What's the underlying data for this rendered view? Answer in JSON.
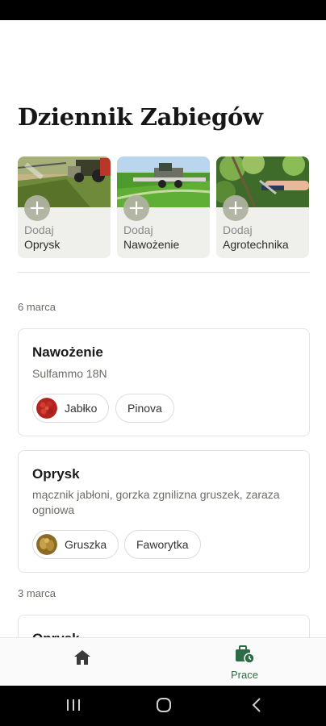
{
  "header": {
    "title": "Dziennik Zabiegów"
  },
  "quick_actions": [
    {
      "line1": "Dodaj",
      "line2": "Oprysk"
    },
    {
      "line1": "Dodaj",
      "line2": "Nawożenie"
    },
    {
      "line1": "Dodaj",
      "line2": "Agrotechnika"
    }
  ],
  "groups": [
    {
      "date": "6 marca",
      "entries": [
        {
          "title": "Nawożenie",
          "subtitle": "Sulfammo 18N",
          "chips": [
            "Jabłko",
            "Pinova"
          ]
        },
        {
          "title": "Oprysk",
          "subtitle": "mącznik jabłoni, gorzka zgnilizna gruszek, zaraza ogniowa",
          "chips": [
            "Gruszka",
            "Faworytka"
          ]
        }
      ]
    },
    {
      "date": "3 marca",
      "entries": [
        {
          "title": "Oprysk"
        }
      ]
    }
  ],
  "bottom_nav": {
    "home_icon": "home-icon",
    "prace_label": "Prace",
    "active_tab": "prace",
    "accent": "#2e6b47"
  },
  "system_nav": {
    "icons": [
      "recent-apps-icon",
      "home-circle-icon",
      "back-icon"
    ]
  }
}
